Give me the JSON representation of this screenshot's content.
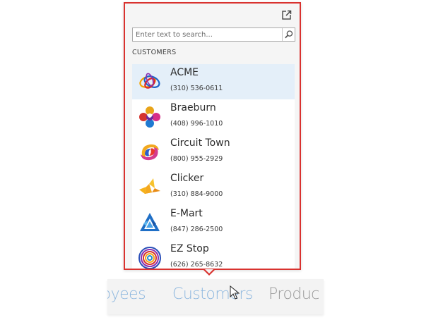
{
  "search": {
    "placeholder": "Enter text to search..."
  },
  "section": {
    "label": "CUSTOMERS"
  },
  "customers": [
    {
      "name": "ACME",
      "phone": "(310) 536-0611"
    },
    {
      "name": "Braeburn",
      "phone": "(408) 996-1010"
    },
    {
      "name": "Circuit Town",
      "phone": "(800) 955-2929"
    },
    {
      "name": "Clicker",
      "phone": "(310) 884-9000"
    },
    {
      "name": "E-Mart",
      "phone": "(847) 286-2500"
    },
    {
      "name": "EZ Stop",
      "phone": "(626) 265-8632"
    }
  ],
  "nav": {
    "employees": "loyees",
    "customers": "Customers",
    "products": "Produc"
  },
  "colors": {
    "popup_border": "#d9322f",
    "selected_row": "#e4eff9",
    "nav_active": "#8fb8df"
  }
}
